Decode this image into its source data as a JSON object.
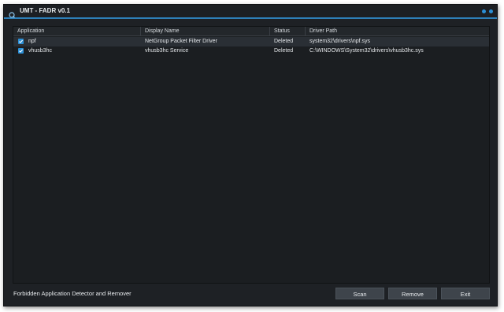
{
  "window": {
    "title": "UMT - FADR v0.1",
    "accent_color": "#2b8fd6"
  },
  "table": {
    "columns": [
      "Application",
      "Display Name",
      "Status",
      "Driver Path"
    ],
    "rows": [
      {
        "checked": true,
        "application": "npf",
        "display_name": "NetGroup Packet Filter Driver",
        "status": "Deleted",
        "driver_path": "system32\\drivers\\npf.sys"
      },
      {
        "checked": true,
        "application": "vhusb3hc",
        "display_name": "vhusb3hc Service",
        "status": "Deleted",
        "driver_path": "C:\\WINDOWS\\System32\\drivers\\vhusb3hc.sys"
      }
    ]
  },
  "footer": {
    "description": "Forbidden Application Detector and Remover",
    "scan_label": "Scan",
    "remove_label": "Remove",
    "exit_label": "Exit"
  },
  "icons": {
    "app": "app-logo-icon",
    "checkbox": "checkmark-icon"
  }
}
